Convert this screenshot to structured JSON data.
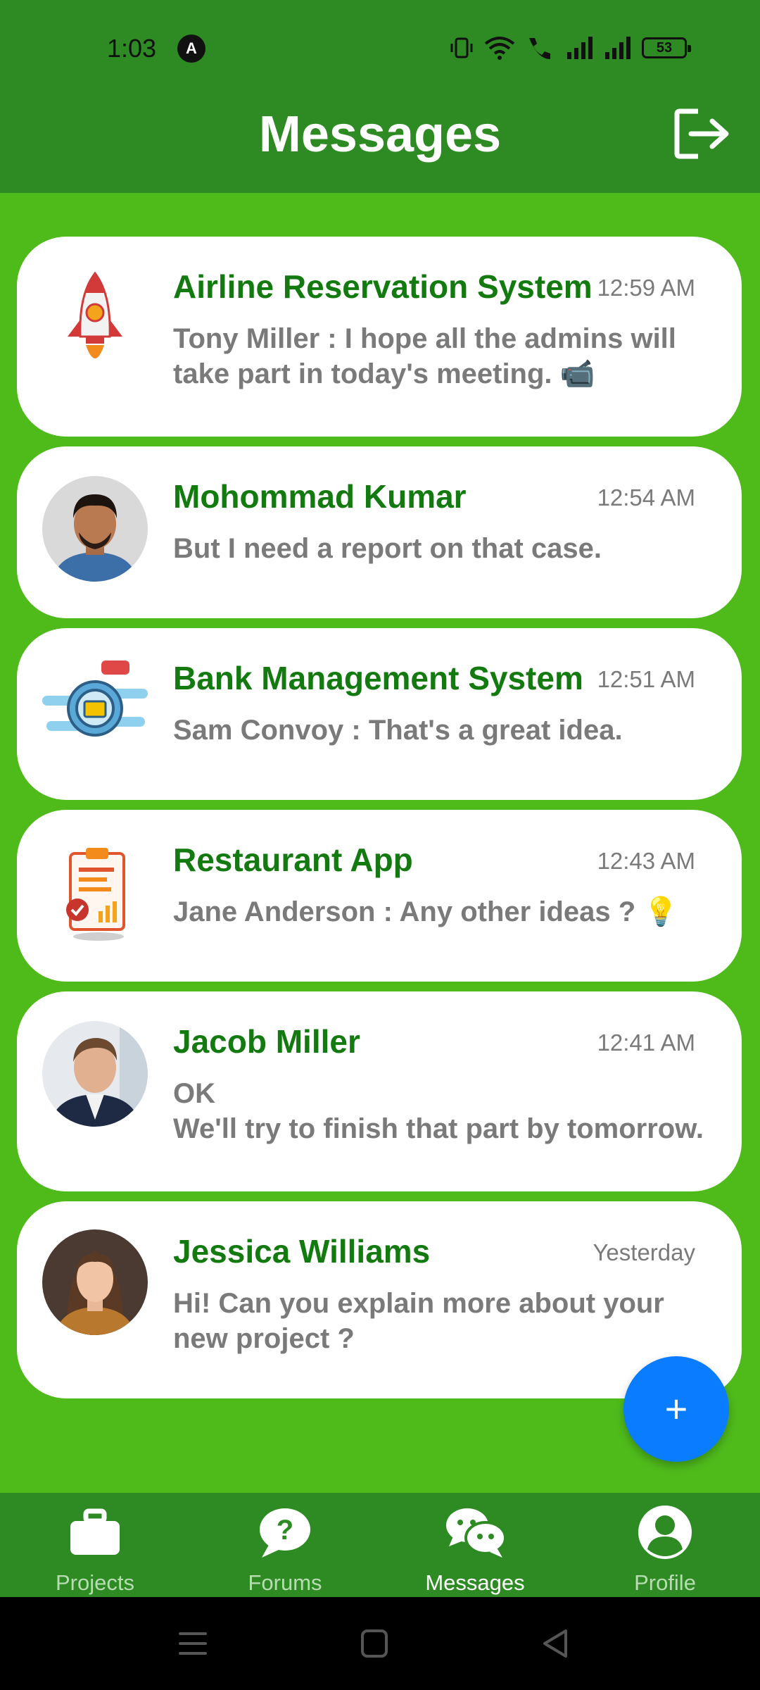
{
  "status": {
    "time": "1:03",
    "app_icon_letter": "A",
    "battery": "53"
  },
  "header": {
    "title": "Messages",
    "logout_icon": "logout-icon"
  },
  "conversations": [
    {
      "name": "Airline Reservation System",
      "time": "12:59 AM",
      "message": "Tony Miller : I hope all the admins will take part in today's meeting. 📹",
      "avatar": "rocket-icon"
    },
    {
      "name": "Mohommad Kumar",
      "time": "12:54 AM",
      "message": "But I need a report on that case.",
      "avatar": "user-photo"
    },
    {
      "name": "Bank Management System",
      "time": "12:51 AM",
      "message": "Sam Convoy : That's a great idea.",
      "avatar": "gear-briefcase-icon"
    },
    {
      "name": "Restaurant App",
      "time": "12:43 AM",
      "message": "Jane Anderson : Any other ideas ? 💡",
      "avatar": "clipboard-chart-icon"
    },
    {
      "name": "Jacob Miller",
      "time": "12:41 AM",
      "message_line1": "OK",
      "message_line2": "We'll try to finish that part by tomorrow.",
      "avatar": "user-photo"
    },
    {
      "name": "Jessica Williams",
      "time": "Yesterday",
      "message": "Hi! Can you explain more about your new project ?",
      "avatar": "user-photo"
    }
  ],
  "fab": {
    "label": "+"
  },
  "nav": {
    "projects": "Projects",
    "forums": "Forums",
    "messages": "Messages",
    "profile": "Profile"
  },
  "colors": {
    "header_green": "#2e8b23",
    "background_green": "#4fbb1b",
    "title_green": "#137a10",
    "fab_blue": "#0a7cff"
  }
}
